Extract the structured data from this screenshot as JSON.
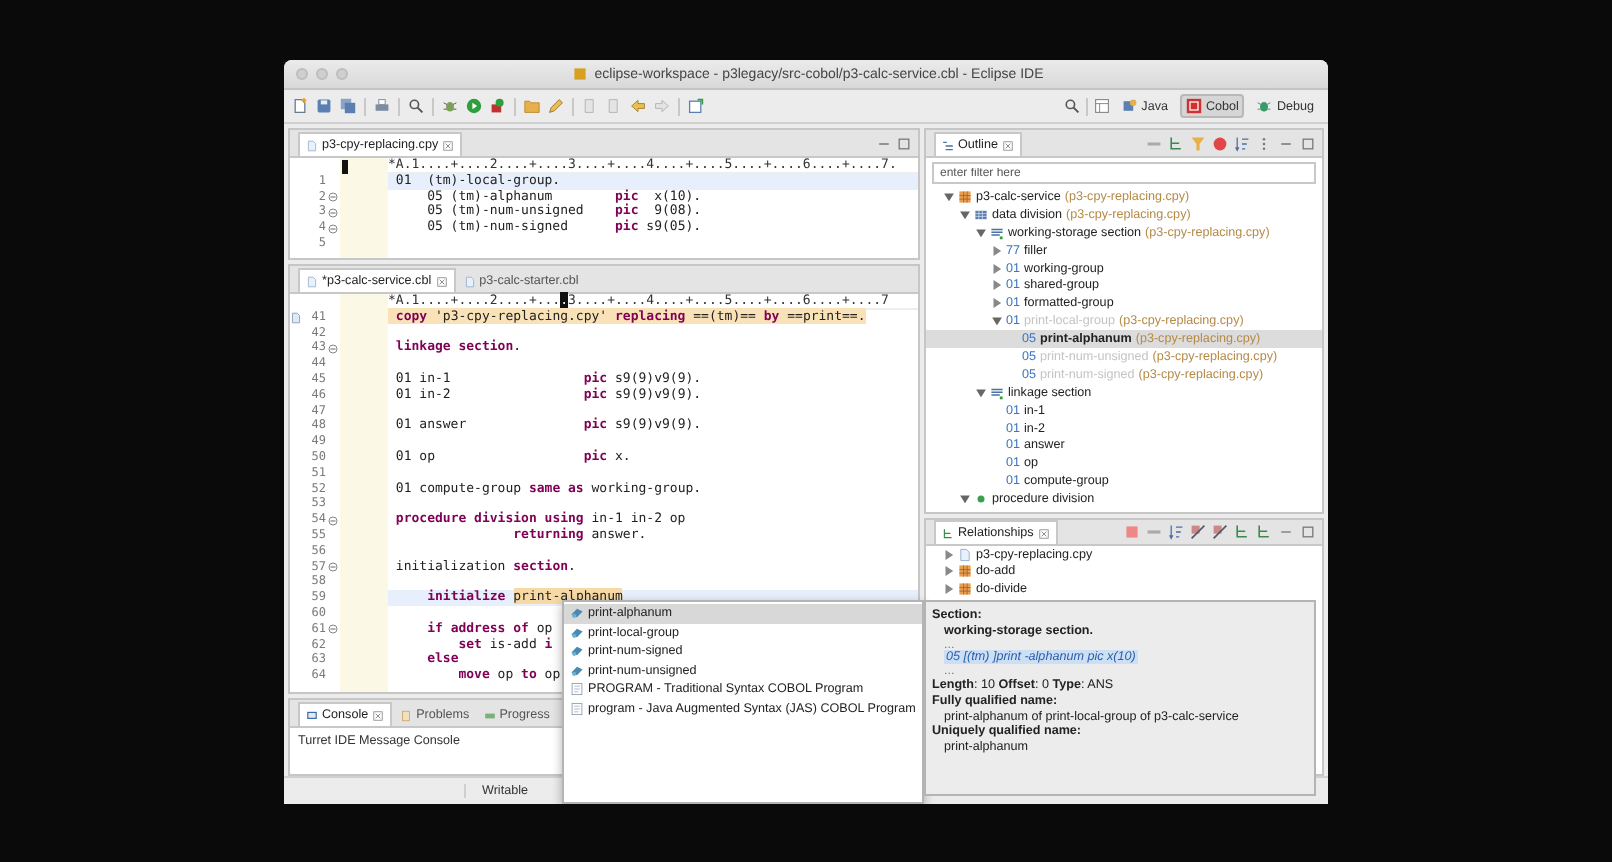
{
  "window": {
    "title": "eclipse-workspace - p3legacy/src-cobol/p3-calc-service.cbl - Eclipse IDE"
  },
  "perspectives": [
    {
      "label": "Java",
      "selected": false
    },
    {
      "label": "Cobol",
      "selected": true
    },
    {
      "label": "Debug",
      "selected": false
    }
  ],
  "editors": [
    {
      "tabs": [
        {
          "label": "p3-cpy-replacing.cpy",
          "selected": true
        }
      ],
      "ruler": [
        {
          "text": "*A.1....+....2....+....3....+....4....+....5....+....6....+....7.",
          "kind": "plain"
        }
      ],
      "lines": [
        {
          "number": "1",
          "fold": false,
          "current": true,
          "highlighted": false,
          "code": [
            {
              "text": " 01  (tm)-local-group.",
              "kind": "code"
            }
          ]
        },
        {
          "number": "2",
          "fold": true,
          "current": false,
          "highlighted": false,
          "code": [
            {
              "text": "     05 (tm)-alphanum        **pic**  x(10).",
              "kind": "code"
            }
          ]
        },
        {
          "number": "3",
          "fold": true,
          "current": false,
          "highlighted": false,
          "code": [
            {
              "text": "     05 (tm)-num-unsigned    **pic**  9(08).",
              "kind": "code"
            }
          ]
        },
        {
          "number": "4",
          "fold": true,
          "current": false,
          "highlighted": false,
          "code": [
            {
              "text": "     05 (tm)-num-signed      **pic** s9(05).",
              "kind": "code"
            }
          ]
        },
        {
          "number": "5",
          "fold": false,
          "current": false
        }
      ]
    },
    {
      "tabs": [
        {
          "label": "*p3-calc-service.cbl",
          "selected": true
        },
        {
          "label": "p3-calc-starter.cbl",
          "selected": false
        }
      ],
      "ruler": [
        {
          "text": "*A.1....+....2....+...",
          "kind": "plain"
        },
        {
          "text": ".",
          "kind": "cursor"
        },
        {
          "text": "3....+....4....+....5....+....6....+....7",
          "kind": "plain"
        }
      ],
      "lines": [
        {
          "number": "41",
          "fold": false,
          "current": false,
          "highlighted": true,
          "marker": true,
          "code": [
            {
              "text": " **copy** 'p3-cpy-replacing.cpy' **replacing** ==(tm)== **by** ==print==.",
              "kind": "code"
            }
          ]
        },
        {
          "number": "42",
          "fold": false,
          "current": false
        },
        {
          "number": "43",
          "fold": true,
          "current": false,
          "highlighted": false,
          "code": [
            {
              "text": " **linkage section**.",
              "kind": "code"
            }
          ]
        },
        {
          "number": "44",
          "fold": false,
          "current": false
        },
        {
          "number": "45",
          "fold": false,
          "current": false,
          "highlighted": false,
          "code": [
            {
              "text": " 01 in-1                 **pic** s9(9)v9(9).",
              "kind": "code"
            }
          ]
        },
        {
          "number": "46",
          "fold": false,
          "current": false,
          "highlighted": false,
          "code": [
            {
              "text": " 01 in-2                 **pic** s9(9)v9(9).",
              "kind": "code"
            }
          ]
        },
        {
          "number": "47",
          "fold": false,
          "current": false
        },
        {
          "number": "48",
          "fold": false,
          "current": false,
          "highlighted": false,
          "code": [
            {
              "text": " 01 answer               **pic** s9(9)v9(9).",
              "kind": "code"
            }
          ]
        },
        {
          "number": "49",
          "fold": false,
          "current": false
        },
        {
          "number": "50",
          "fold": false,
          "current": false,
          "highlighted": false,
          "code": [
            {
              "text": " 01 op                   **pic** x.",
              "kind": "code"
            }
          ]
        },
        {
          "number": "51",
          "fold": false,
          "current": false
        },
        {
          "number": "52",
          "fold": false,
          "current": false,
          "highlighted": false,
          "code": [
            {
              "text": " 01 compute-group **same as** working-group.",
              "kind": "code"
            }
          ]
        },
        {
          "number": "53",
          "fold": false,
          "current": false
        },
        {
          "number": "54",
          "fold": true,
          "current": false,
          "highlighted": false,
          "code": [
            {
              "text": " **procedure division using** in-1 in-2 op",
              "kind": "code"
            }
          ]
        },
        {
          "number": "55",
          "fold": false,
          "current": false,
          "highlighted": false,
          "code": [
            {
              "text": "                **returning** answer.",
              "kind": "code"
            }
          ]
        },
        {
          "number": "56",
          "fold": false,
          "current": false
        },
        {
          "number": "57",
          "fold": true,
          "current": false,
          "highlighted": false,
          "code": [
            {
              "text": " initialization **section**.",
              "kind": "code"
            }
          ]
        },
        {
          "number": "58",
          "fold": false,
          "current": false
        },
        {
          "number": "59",
          "fold": false,
          "current": true,
          "highlighted": false,
          "code": [
            {
              "text": "     **initialize** ",
              "kind": "code"
            },
            {
              "text": "print-alphanum",
              "kind": "match"
            }
          ]
        },
        {
          "number": "60",
          "fold": false,
          "current": false
        },
        {
          "number": "61",
          "fold": true,
          "current": false,
          "highlighted": false,
          "code": [
            {
              "text": "     **if address of** op",
              "kind": "code"
            }
          ]
        },
        {
          "number": "62",
          "fold": false,
          "current": false,
          "highlighted": false,
          "code": [
            {
              "text": "         **set** is-add **i**",
              "kind": "code"
            }
          ]
        },
        {
          "number": "63",
          "fold": false,
          "current": false,
          "highlighted": false,
          "code": [
            {
              "text": "     **else**",
              "kind": "code"
            }
          ]
        },
        {
          "number": "64",
          "fold": false,
          "current": false,
          "highlighted": false,
          "code": [
            {
              "text": "         **move** op **to** op",
              "kind": "code"
            }
          ]
        }
      ]
    }
  ],
  "console": {
    "tabs": [
      {
        "label": "Console",
        "selected": true
      },
      {
        "label": "Problems",
        "selected": false
      },
      {
        "label": "Progress",
        "selected": false
      }
    ],
    "text": "Turret IDE Message Console"
  },
  "status_bar": {
    "text": "Writable"
  },
  "outline": {
    "tab": {
      "label": "Outline",
      "selected": true
    },
    "filter": {
      "placeholder": "enter filter here"
    },
    "items": [
      {
        "kind": "program",
        "name": "p3-calc-service",
        "source": "(p3-cpy-replacing.cpy)",
        "expanded": true,
        "selected": false,
        "dimmed": false,
        "children": [
          {
            "kind": "division",
            "name": "data division",
            "source": "(p3-cpy-replacing.cpy)",
            "expanded": true,
            "selected": false,
            "dimmed": false,
            "children": [
              {
                "kind": "section",
                "name": "working-storage section",
                "source": "(p3-cpy-replacing.cpy)",
                "expanded": true,
                "selected": false,
                "dimmed": false,
                "children": [
                  {
                    "number": "77",
                    "name": "filler",
                    "expanded": false,
                    "selected": false,
                    "dimmed": false
                  },
                  {
                    "number": "01",
                    "name": "working-group",
                    "expanded": false,
                    "selected": false,
                    "dimmed": false
                  },
                  {
                    "number": "01",
                    "name": "shared-group",
                    "expanded": false,
                    "selected": false,
                    "dimmed": false
                  },
                  {
                    "number": "01",
                    "name": "formatted-group",
                    "expanded": false,
                    "selected": false,
                    "dimmed": false
                  },
                  {
                    "number": "01",
                    "name": "print-local-group",
                    "source": "(p3-cpy-replacing.cpy)",
                    "expanded": true,
                    "selected": false,
                    "dimmed": true,
                    "children": [
                      {
                        "number": "05",
                        "name": "print-alphanum",
                        "source": "(p3-cpy-replacing.cpy)",
                        "selected": true,
                        "dimmed": false
                      },
                      {
                        "number": "05",
                        "name": "print-num-unsigned",
                        "source": "(p3-cpy-replacing.cpy)",
                        "selected": false,
                        "dimmed": true
                      },
                      {
                        "number": "05",
                        "name": "print-num-signed",
                        "source": "(p3-cpy-replacing.cpy)",
                        "selected": false,
                        "dimmed": true
                      }
                    ]
                  }
                ]
              },
              {
                "kind": "section",
                "name": "linkage section",
                "expanded": true,
                "selected": false,
                "dimmed": false,
                "children": [
                  {
                    "number": "01",
                    "name": "in-1",
                    "selected": false,
                    "dimmed": false
                  },
                  {
                    "number": "01",
                    "name": "in-2",
                    "selected": false,
                    "dimmed": false
                  },
                  {
                    "number": "01",
                    "name": "answer",
                    "selected": false,
                    "dimmed": false
                  },
                  {
                    "number": "01",
                    "name": "op",
                    "selected": false,
                    "dimmed": false
                  },
                  {
                    "number": "01",
                    "name": "compute-group",
                    "selected": false,
                    "dimmed": false
                  }
                ]
              }
            ]
          },
          {
            "kind": "procedure",
            "name": "procedure division",
            "expanded": true,
            "selected": false,
            "dimmed": false
          }
        ]
      }
    ]
  },
  "relationships": {
    "tab": {
      "label": "Relationships",
      "selected": true
    },
    "items": [
      {
        "kind": "file",
        "name": "p3-cpy-replacing.cpy",
        "expanded": false,
        "selected": false
      },
      {
        "kind": "program",
        "name": "do-add",
        "expanded": false,
        "selected": false
      },
      {
        "kind": "program",
        "name": "do-divide",
        "expanded": false,
        "selected": false
      }
    ]
  },
  "content_assist": {
    "items": [
      {
        "kind": "variable",
        "label": "print-alphanum",
        "selected": true
      },
      {
        "kind": "variable",
        "label": "print-local-group",
        "selected": false
      },
      {
        "kind": "variable",
        "label": "print-num-signed",
        "selected": false
      },
      {
        "kind": "variable",
        "label": "print-num-unsigned",
        "selected": false
      },
      {
        "kind": "template",
        "label": "PROGRAM - Traditional Syntax COBOL Program",
        "selected": false
      },
      {
        "kind": "template",
        "label": "program - Java Augmented Syntax (JAS) COBOL Program",
        "selected": false
      }
    ]
  },
  "info": {
    "section_label": "Section:",
    "section": "working-storage section.",
    "ellipsis_before": "...",
    "declaration": "05 [(tm) ]print -alphanum pic x(10)",
    "ellipsis_after": "...",
    "attributes": "**Length**: 10 **Offset**: 0 **Type**: ANS",
    "fully_qualified_label": "Fully qualified name:",
    "fully_qualified": "print-alphanum of print-local-group of p3-calc-service",
    "unique_label": "Uniquely qualified name:",
    "unique": "print-alphanum"
  }
}
